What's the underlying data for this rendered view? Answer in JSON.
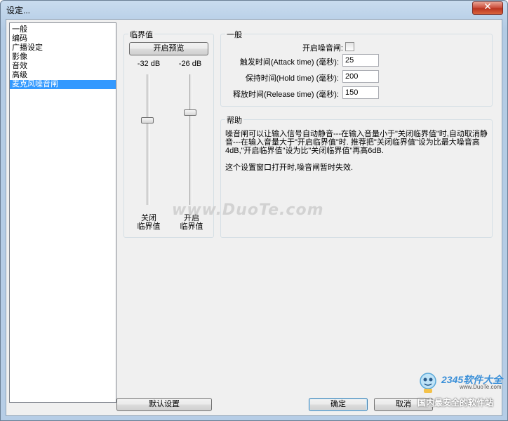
{
  "window": {
    "title": "设定...",
    "close_icon": "close-icon"
  },
  "nav": {
    "items": [
      {
        "label": "一般",
        "selected": false
      },
      {
        "label": "编码",
        "selected": false
      },
      {
        "label": "广播设定",
        "selected": false
      },
      {
        "label": "影像",
        "selected": false
      },
      {
        "label": "音效",
        "selected": false
      },
      {
        "label": "高级",
        "selected": false
      },
      {
        "label": "麦克风噪音闸",
        "selected": true
      }
    ]
  },
  "threshold": {
    "group_label": "临界值",
    "preview_button": "开启预览",
    "close_db": "-32 dB",
    "open_db": "-26 dB",
    "close_caption_line1": "关闭",
    "close_caption_line2": "临界值",
    "open_caption_line1": "开启",
    "open_caption_line2": "临界值",
    "close_slider_level": 0.35,
    "open_slider_level": 0.29
  },
  "general": {
    "group_label": "一般",
    "enable_label": "开启噪音闸:",
    "enable_checked": false,
    "attack_label": "触发时间(Attack time) (毫秒):",
    "attack_value": "25",
    "hold_label": "保持时间(Hold time) (毫秒):",
    "hold_value": "200",
    "release_label": "释放时间(Release time) (毫秒):",
    "release_value": "150"
  },
  "help": {
    "group_label": "帮助",
    "paragraph1": "噪音闸可以让输入信号自动静音---在输入音量小于\"关闭临界值\"时,自动取消静音---在输入音量大于\"开启临界值\"时. 推荐把\"关闭临界值\"设为比最大噪音高4dB,\"开启临界值\"设为比\"关闭临界值\"再高6dB.",
    "paragraph2": "这个设置窗口打开时,噪音闸暂时失效."
  },
  "footer": {
    "defaults_button": "默认设置",
    "ok_button": "确定",
    "cancel_button": "取消"
  },
  "watermark": {
    "text": "www.DuoTe.com",
    "corner_brand": "2345软件大全",
    "corner_url": "www.DuoTe.com",
    "corner_caption": "国内最安全的软件站"
  }
}
